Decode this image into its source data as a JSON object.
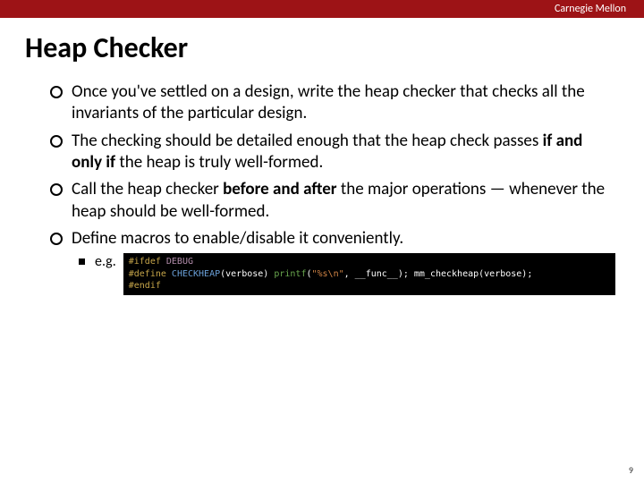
{
  "header": {
    "brand": "Carnegie Mellon"
  },
  "title": "Heap Checker",
  "bullets": [
    {
      "pre": "Once you've settled on a design, write the heap checker that checks all the invariants of the particular design."
    },
    {
      "pre": "The checking should be detailed enough that the heap check passes ",
      "bold1": "if and only if",
      "post": " the heap is truly well-formed."
    },
    {
      "pre": "Call the heap checker ",
      "bold1": "before and after",
      "post": " the major operations — whenever the heap should be well-formed."
    },
    {
      "pre": "Define macros to enable/disable it conveniently."
    }
  ],
  "sub": {
    "label": "e.g."
  },
  "code": {
    "l1a": "#ifdef",
    "l1b": " DEBUG",
    "l2a": "#define",
    "l2b": " CHECKHEAP",
    "l2c": "(verbose) ",
    "l2d": "printf",
    "l2e": "(",
    "l2f": "\"%s\\n\"",
    "l2g": ", __func__); mm_checkheap(verbose);",
    "l3": "#endif"
  },
  "pagenum": "9"
}
